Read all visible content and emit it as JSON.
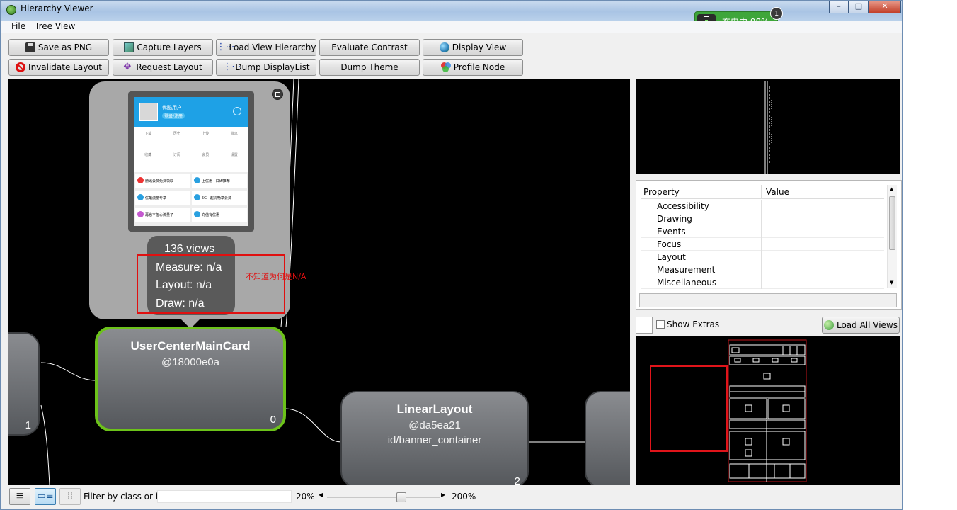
{
  "window": {
    "title": "Hierarchy Viewer"
  },
  "battery": {
    "label": "充电中 98%",
    "badge": "1"
  },
  "menu": {
    "file": "File",
    "tree_view": "Tree View"
  },
  "toolbar": {
    "row1": [
      "Save as PNG",
      "Capture Layers",
      "Load View Hierarchy",
      "Evaluate Contrast",
      "Display View"
    ],
    "row2": [
      "Invalidate Layout",
      "Request Layout",
      "Dump DisplayList",
      "Dump Theme",
      "Profile Node"
    ]
  },
  "tooltip": {
    "views": "136 views",
    "measure": "Measure: n/a",
    "layout": "Layout: n/a",
    "draw": "Draw: n/a",
    "annotation": "不知道为何是N/A",
    "phone": {
      "username": "优酷用户",
      "login": "登录/注册",
      "grid_row1": [
        "下载",
        "历史",
        "上传",
        "消息"
      ],
      "grid_row2": [
        "收藏",
        "订阅",
        "会员",
        "设置"
      ],
      "list": [
        "腾讯会员免费领取",
        "上优惠 · 口碑推荐",
        "优酷流量专享",
        "5G · 超清畅享会员",
        "再也不担心流量了",
        "充值有优惠"
      ]
    }
  },
  "nodes": {
    "left": {
      "index": "1"
    },
    "main": {
      "name": "UserCenterMainCard",
      "hash": "@18000e0a",
      "index": "0"
    },
    "linear": {
      "name": "LinearLayout",
      "hash": "@da5ea21",
      "id": "id/banner_container",
      "index": "2"
    }
  },
  "properties": {
    "header_property": "Property",
    "header_value": "Value",
    "rows": [
      "Accessibility",
      "Drawing",
      "Events",
      "Focus",
      "Layout",
      "Measurement",
      "Miscellaneous"
    ]
  },
  "extras": {
    "show_extras": "Show Extras",
    "load_all": "Load All Views"
  },
  "statusbar": {
    "filter_label": "Filter by class or id:",
    "filter_value": "",
    "zoom_min": "20%",
    "zoom_max": "200%",
    "zoom_level": 0.67
  },
  "colors": {
    "selected_border": "#6cc21a",
    "annotation_red": "#e01010",
    "battery_green": "#3ea63a"
  }
}
